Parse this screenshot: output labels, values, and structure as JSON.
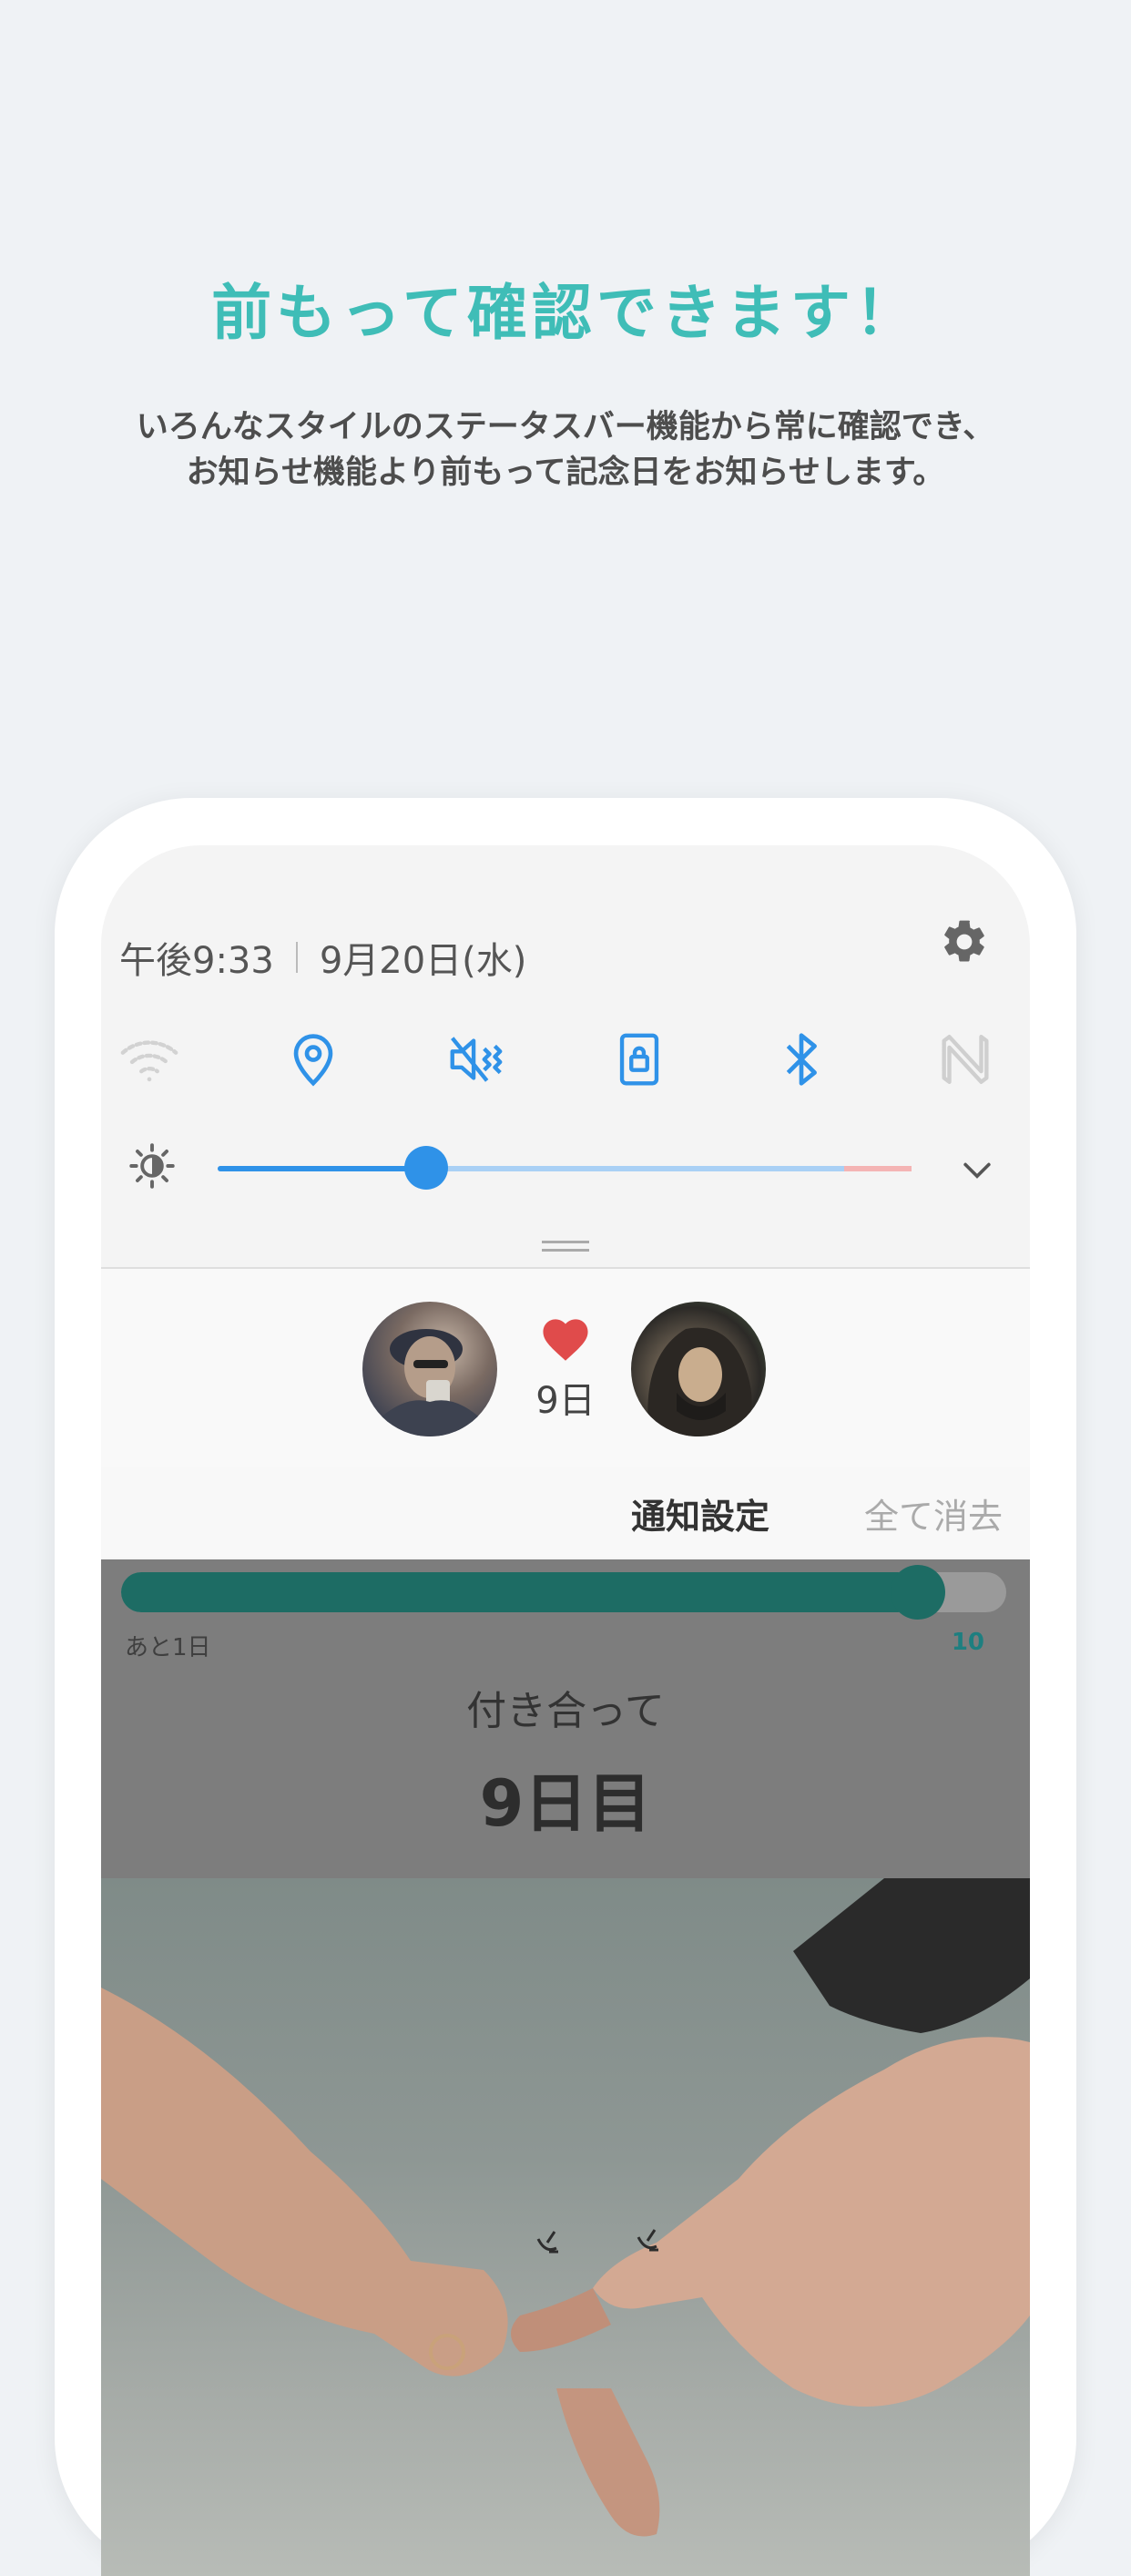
{
  "headline": "前もって確認できます！",
  "description": {
    "line1": "いろんなスタイルのステータスバー機能から常に確認でき、",
    "line2": "お知らせ機能より前もって記念日をお知らせします。"
  },
  "status_panel": {
    "time": "午後9:33",
    "date": "9月20日(水)",
    "quick_settings": [
      {
        "name": "wifi-icon",
        "active": false
      },
      {
        "name": "location-icon",
        "active": true
      },
      {
        "name": "vibrate-icon",
        "active": true
      },
      {
        "name": "rotation-lock-icon",
        "active": true
      },
      {
        "name": "bluetooth-icon",
        "active": true
      },
      {
        "name": "nfc-icon",
        "active": false
      }
    ],
    "brightness_level": 0.3,
    "colors": {
      "accent": "#2f92e8",
      "inactive": "#c8c8c8"
    }
  },
  "notification": {
    "days_label": "9日",
    "heart_color": "#e04b4b"
  },
  "notification_actions": {
    "settings_label": "通知設定",
    "clear_label": "全て消去"
  },
  "widget": {
    "progress_fraction": 0.9,
    "remaining_label": "あと1日",
    "target_value": "10",
    "title": "付き合って",
    "day_count": "9日目",
    "accent": "#1d6c64"
  }
}
